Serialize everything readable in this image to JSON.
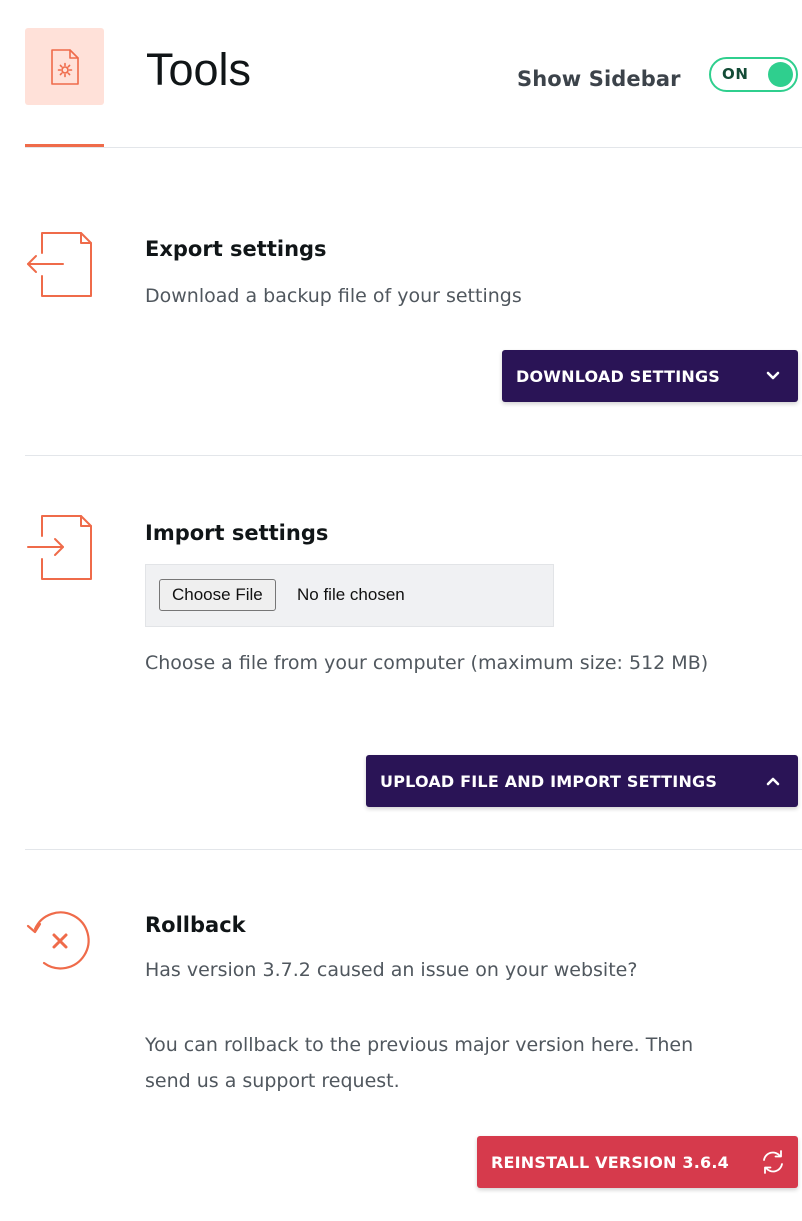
{
  "header": {
    "icon": "gear-document-icon",
    "title": "Tools",
    "sidebar_label": "Show Sidebar",
    "toggle_state": "ON"
  },
  "export": {
    "icon": "export-file-icon",
    "title": "Export settings",
    "description": "Download a backup file of your settings",
    "button_label": "DOWNLOAD SETTINGS",
    "button_icon": "chevron-down-icon"
  },
  "import": {
    "icon": "import-file-icon",
    "title": "Import settings",
    "file_button_label": "Choose File",
    "file_status": "No file chosen",
    "description": "Choose a file from your computer (maximum size: 512 MB)",
    "button_label": "UPLOAD FILE AND IMPORT SETTINGS",
    "button_icon": "chevron-up-icon"
  },
  "rollback": {
    "icon": "rollback-icon",
    "title": "Rollback",
    "question": "Has version 3.7.2 caused an issue on your website?",
    "instructions": "You can rollback to the previous major version here. Then send us a support request.",
    "button_label": "REINSTALL VERSION 3.6.4",
    "button_icon": "refresh-icon"
  },
  "colors": {
    "accent": "#ef6b4a",
    "accent_tile": "#ffe1d9",
    "toggle_green": "#2fcf8e",
    "button_dark": "#2a1456",
    "button_red": "#d63a4c"
  }
}
